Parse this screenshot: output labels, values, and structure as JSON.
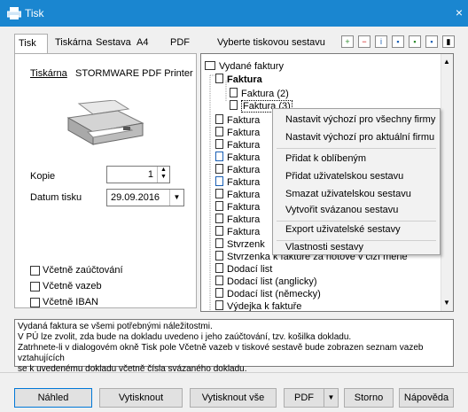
{
  "window": {
    "title": "Tisk",
    "close_symbol": "×"
  },
  "tabs": [
    "Tisk",
    "Tiskárna",
    "Sestava",
    "A4",
    "PDF"
  ],
  "selected_set_label": "Vyberte tiskovou sestavu",
  "toolbar_icons": [
    {
      "name": "add-set-icon",
      "glyph": "+"
    },
    {
      "name": "remove-set-icon",
      "glyph": "−"
    },
    {
      "name": "info-icon",
      "glyph": "i"
    },
    {
      "name": "edit-set-icon",
      "glyph": "▪"
    },
    {
      "name": "export-icon",
      "glyph": "▪"
    },
    {
      "name": "new-window-icon",
      "glyph": "▪"
    },
    {
      "name": "properties-icon",
      "glyph": "▮"
    }
  ],
  "printer": {
    "label": "Tiskárna",
    "name": "STORMWARE PDF Printer"
  },
  "copies": {
    "label": "Kopie",
    "value": "1"
  },
  "print_date": {
    "label": "Datum tisku",
    "value": "29.09.2016"
  },
  "options": [
    "Včetně zaúčtování",
    "Včetně vazeb",
    "Včetně IBAN"
  ],
  "tree": {
    "root": "Vydané faktury",
    "group": "Faktura",
    "items": [
      "Faktura (2)",
      "Faktura (3)",
      "Faktura",
      "Faktura",
      "Faktura",
      "Faktura",
      "Faktura",
      "Faktura",
      "Faktura",
      "Faktura",
      "Faktura",
      "Faktura",
      "Stvrzenk",
      "Stvrzenka k faktuře za hotové v cizí měně",
      "Dodací list",
      "Dodací list (anglicky)",
      "Dodací list (německy)",
      "Výdejka k faktuře"
    ]
  },
  "context_menu": [
    "Nastavit výchozí pro všechny firmy",
    "Nastavit výchozí pro aktuální firmu",
    "Přidat k oblíbeným",
    "Přidat uživatelskou sestavu",
    "Smazat uživatelskou sestavu",
    "Vytvořit svázanou sestavu",
    "Export uživatelské sestavy",
    "Vlastnosti sestavy"
  ],
  "description": [
    "Vydaná faktura se všemi potřebnými náležitostmi.",
    "V PÚ lze zvolit, zda bude na dokladu uvedeno i jeho zaúčtování, tzv. košilka dokladu.",
    "Zatrhnete-li v dialogovém okně Tisk pole Včetně vazeb v tiskové sestavě bude zobrazen seznam vazeb vztahujících",
    "se k uvedenému dokladu včetně čísla svázaného dokladu."
  ],
  "buttons": {
    "preview": "Náhled",
    "print": "Vytisknout",
    "print_all": "Vytisknout vše",
    "pdf": "PDF",
    "cancel": "Storno",
    "help": "Nápověda"
  },
  "colors": {
    "titlebar": "#1a86d0",
    "primary_border": "#0078d7"
  }
}
